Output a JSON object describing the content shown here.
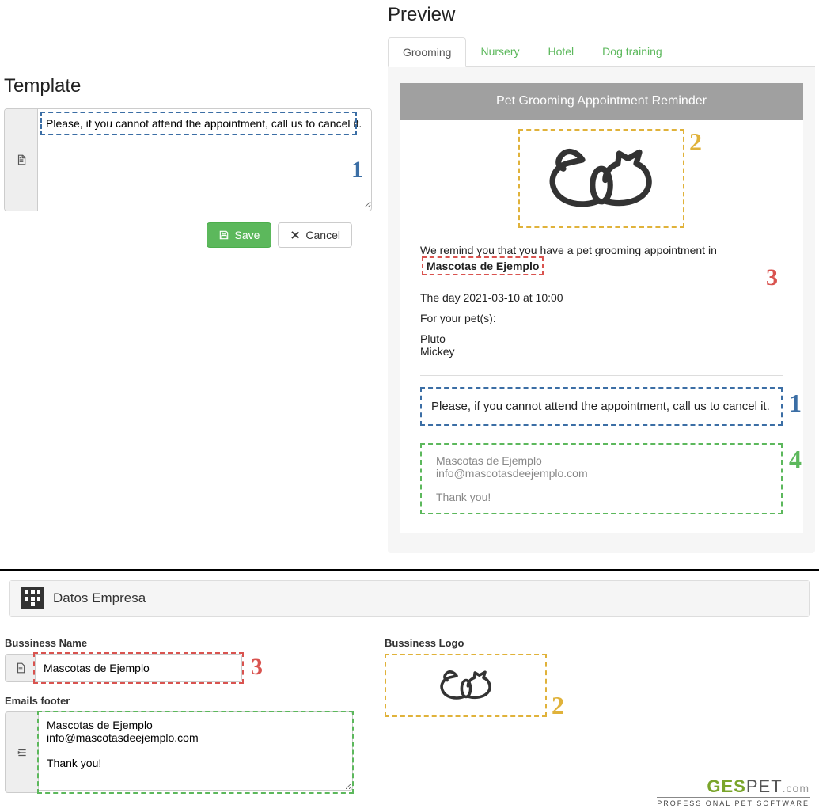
{
  "template": {
    "heading": "Template",
    "message": "Please, if you cannot attend the appointment, call us to cancel it.",
    "save_label": "Save",
    "cancel_label": "Cancel",
    "annot_1": "1"
  },
  "preview": {
    "heading": "Preview",
    "tabs": [
      {
        "label": "Grooming",
        "active": true
      },
      {
        "label": "Nursery",
        "active": false
      },
      {
        "label": "Hotel",
        "active": false
      },
      {
        "label": "Dog training",
        "active": false
      }
    ],
    "email_header": "Pet Grooming Appointment Reminder",
    "remind_prefix": "We remind you that you have a pet grooming appointment in",
    "business_name": "Mascotas de Ejemplo",
    "date_line": "The day 2021-03-10 at 10:00",
    "for_pets": "For your pet(s):",
    "pets": [
      "Pluto",
      "Mickey"
    ],
    "custom_message": "Please, if you cannot attend the appointment, call us to cancel it.",
    "footer_name": "Mascotas de Ejemplo",
    "footer_email": "info@mascotasdeejemplo.com",
    "footer_thanks": "Thank you!",
    "annots": {
      "n1": "1",
      "n2": "2",
      "n3": "3",
      "n4": "4"
    }
  },
  "company": {
    "heading": "Datos Empresa",
    "bn_label": "Bussiness Name",
    "bn_value": "Mascotas de Ejemplo",
    "ef_label": "Emails footer",
    "ef_value": "Mascotas de Ejemplo\ninfo@mascotasdeejemplo.com\n\nThank you!",
    "logo_label": "Bussiness Logo",
    "annots": {
      "n2": "2",
      "n3": "3"
    }
  },
  "brand": {
    "g": "GES",
    "rest": "PET",
    "com": ".com",
    "sub": "PROFESSIONAL PET SOFTWARE"
  }
}
